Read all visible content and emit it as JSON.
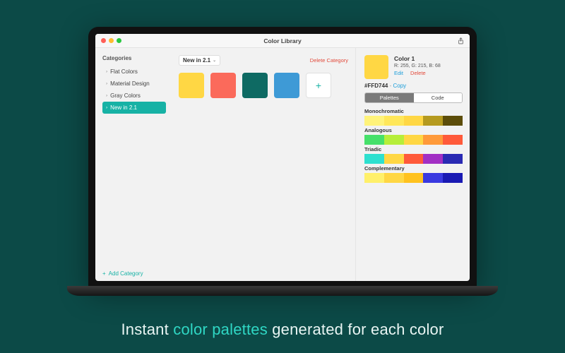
{
  "window": {
    "title": "Color Library",
    "traffic": {
      "close": "#ff5f57",
      "min": "#febc2e",
      "max": "#28c840"
    }
  },
  "sidebar": {
    "heading": "Categories",
    "items": [
      {
        "label": "Flat Colors",
        "active": false
      },
      {
        "label": "Material Design",
        "active": false
      },
      {
        "label": "Gray Colors",
        "active": false
      },
      {
        "label": "New in 2.1",
        "active": true
      }
    ],
    "add_label": "Add Category"
  },
  "main": {
    "current_category": "New in 2.1",
    "delete_category_label": "Delete Category",
    "swatches": [
      {
        "hex": "#ffd744"
      },
      {
        "hex": "#fb6a5b"
      },
      {
        "hex": "#0e6a63"
      },
      {
        "hex": "#3e9ad6"
      }
    ]
  },
  "detail": {
    "name": "Color 1",
    "rgb_label": "R: 255, G: 215, B: 68",
    "edit_label": "Edit",
    "delete_label": "Delete",
    "hex": "#FFD744",
    "copy_label": "Copy",
    "segments": {
      "palettes": "Palettes",
      "code": "Code",
      "active": "palettes"
    },
    "preview_hex": "#ffd744",
    "schemes": [
      {
        "title": "Monochromatic",
        "colors": [
          "#fff37a",
          "#ffe75a",
          "#ffd744",
          "#b59a1f",
          "#5c4d0a"
        ]
      },
      {
        "title": "Analogous",
        "colors": [
          "#46e06a",
          "#b6ee3a",
          "#ffd744",
          "#ff9a3a",
          "#ff5a3a"
        ]
      },
      {
        "title": "Triadic",
        "colors": [
          "#2ee0cf",
          "#ffd744",
          "#ff5a3a",
          "#a22fc4",
          "#2a2ab3"
        ]
      },
      {
        "title": "Complementary",
        "colors": [
          "#fff06a",
          "#ffd744",
          "#ffc21f",
          "#3a3ae0",
          "#1a1ab3"
        ]
      }
    ]
  },
  "tagline": {
    "pre": "Instant ",
    "highlight": "color palettes",
    "post": " generated for each color"
  }
}
